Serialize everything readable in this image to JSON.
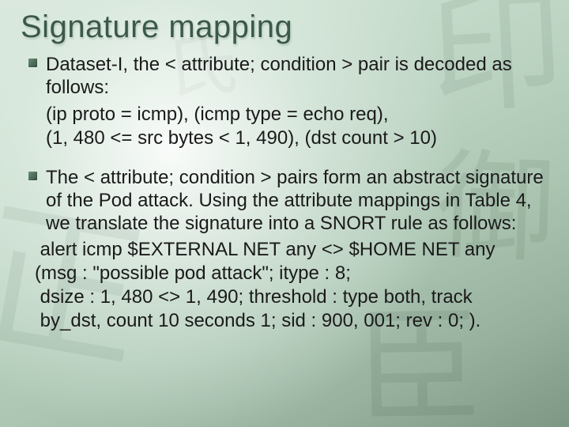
{
  "slide": {
    "title": "Signature mapping",
    "bullets": [
      {
        "lead": "Dataset-I, the < attribute; condition > pair is decoded as follows:",
        "detail": "(ip proto = icmp), (icmp type = echo req),\n(1, 480 <= src bytes < 1, 490), (dst count > 10)"
      },
      {
        "lead": "The < attribute; condition > pairs form an abstract signature of the Pod attack. Using the attribute mappings in Table 4, we translate the signature into a SNORT rule as follows:",
        "detail": " alert icmp $EXTERNAL NET any <> $HOME NET any\n(msg : \"possible pod attack\"; itype : 8;\n dsize : 1, 480 <> 1, 490; threshold : type both, track\n by_dst, count 10 seconds 1; sid : 900, 001; rev : 0; )."
      }
    ]
  }
}
